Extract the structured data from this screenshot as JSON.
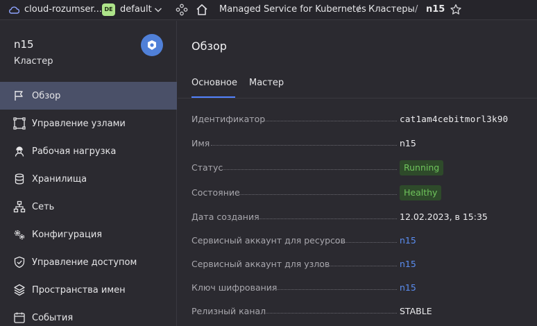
{
  "topbar": {
    "cloud_name": "cloud-rozumser...",
    "folder_badge": "DE",
    "folder_name": "default",
    "breadcrumbs": [
      "Managed Service for Kubernetes",
      "Кластеры",
      "n15"
    ]
  },
  "sidebar": {
    "title": "n15",
    "subtitle": "Кластер",
    "items": [
      {
        "label": "Обзор",
        "icon": "flag-icon",
        "active": true
      },
      {
        "label": "Управление узлами",
        "icon": "nodes-frame-icon"
      },
      {
        "label": "Рабочая нагрузка",
        "icon": "worker-icon"
      },
      {
        "label": "Хранилища",
        "icon": "database-icon"
      },
      {
        "label": "Сеть",
        "icon": "network-icon"
      },
      {
        "label": "Конфигурация",
        "icon": "gears-icon"
      },
      {
        "label": "Управление доступом",
        "icon": "shield-icon"
      },
      {
        "label": "Пространства имен",
        "icon": "layers-icon"
      },
      {
        "label": "События",
        "icon": "calendar-icon"
      }
    ]
  },
  "main": {
    "title": "Обзор",
    "tabs": [
      {
        "label": "Основное",
        "active": true
      },
      {
        "label": "Мастер"
      }
    ],
    "rows": [
      {
        "label": "Идентификатор",
        "value": "cat1am4cebitmorl3k90",
        "kind": "mono"
      },
      {
        "label": "Имя",
        "value": "n15",
        "kind": "text"
      },
      {
        "label": "Статус",
        "value": "Running",
        "kind": "badge"
      },
      {
        "label": "Состояние",
        "value": "Healthy",
        "kind": "badge"
      },
      {
        "label": "Дата создания",
        "value": "12.02.2023, в 15:35",
        "kind": "text"
      },
      {
        "label": "Сервисный аккаунт для ресурсов",
        "value": "n15",
        "kind": "link"
      },
      {
        "label": "Сервисный аккаунт для узлов",
        "value": "n15",
        "kind": "link"
      },
      {
        "label": "Ключ шифрования",
        "value": "n15",
        "kind": "link"
      },
      {
        "label": "Релизный канал",
        "value": "STABLE",
        "kind": "text"
      }
    ]
  },
  "colors": {
    "accent": "#5282ff",
    "active_nav": "#4a5068",
    "badge_bg": "#2e4a2a",
    "badge_text": "#6fc45c",
    "link": "#5b8ef2"
  }
}
